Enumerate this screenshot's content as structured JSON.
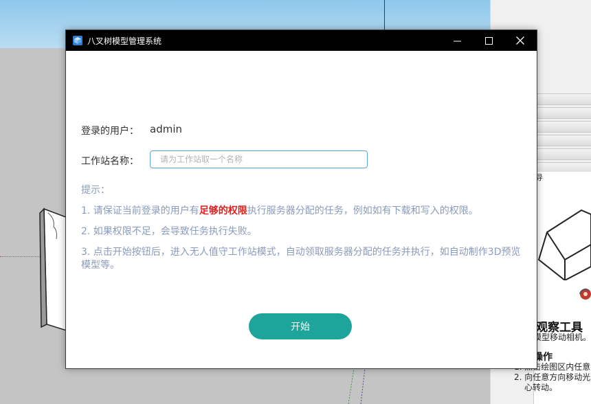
{
  "background_app": {
    "tray_guide_fragment": "导",
    "tray_heading": "观察工具",
    "tray_description": "模型移动相机。",
    "tray_subheading": "操作",
    "tray_steps": [
      "1. 点击绘图区内任意",
      "2. 向任意方向移动光",
      "心转动。"
    ]
  },
  "window": {
    "title": "八叉树模型管理系统"
  },
  "form": {
    "user_label": "登录的用户：",
    "user_value": "admin",
    "workstation_label": "工作站名称：",
    "workstation_placeholder": "请为工作站取一个名称",
    "workstation_value": ""
  },
  "tips": {
    "title": "提示：",
    "tip1_before": "1. 请保证当前登录的用户有",
    "tip1_highlight": "足够的权限",
    "tip1_after": "执行服务器分配的任务，例如如有下载和写入的权限。",
    "tip2": "2. 如果权限不足，会导致任务执行失败。",
    "tip3": "3. 点击开始按钮后，进入无人值守工作站模式，自动领取服务器分配的任务并执行，如自动制作3D预览模型等。"
  },
  "start_button": "开始",
  "colors": {
    "titlebar": "#000000",
    "tip_text": "#8a9bbd",
    "highlight": "#e51c1c",
    "primary_button": "#1da59b",
    "input_border": "#5aa8d8"
  },
  "icons": {
    "app": "cube-icon",
    "minimize": "minimize-icon",
    "maximize": "maximize-icon",
    "close": "close-icon"
  }
}
